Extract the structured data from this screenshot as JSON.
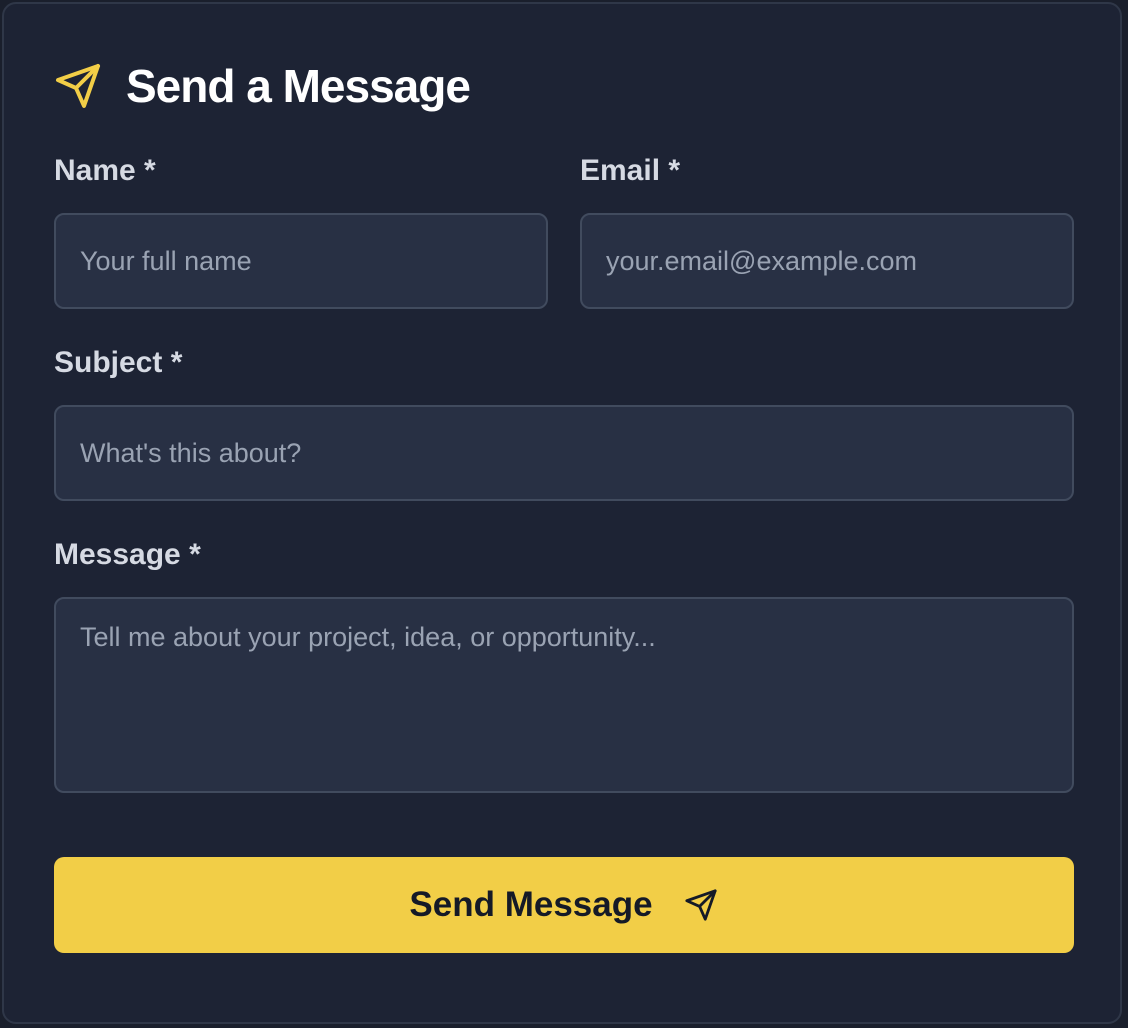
{
  "form": {
    "title": "Send a Message",
    "title_icon": "send-icon",
    "accent_color": "#f2ce47",
    "fields": {
      "name": {
        "label": "Name *",
        "placeholder": "Your full name",
        "value": ""
      },
      "email": {
        "label": "Email *",
        "placeholder": "your.email@example.com",
        "value": ""
      },
      "subject": {
        "label": "Subject *",
        "placeholder": "What's this about?",
        "value": ""
      },
      "message": {
        "label": "Message *",
        "placeholder": "Tell me about your project, idea, or opportunity...",
        "value": ""
      }
    },
    "submit": {
      "label": "Send Message",
      "icon": "send-icon"
    }
  }
}
